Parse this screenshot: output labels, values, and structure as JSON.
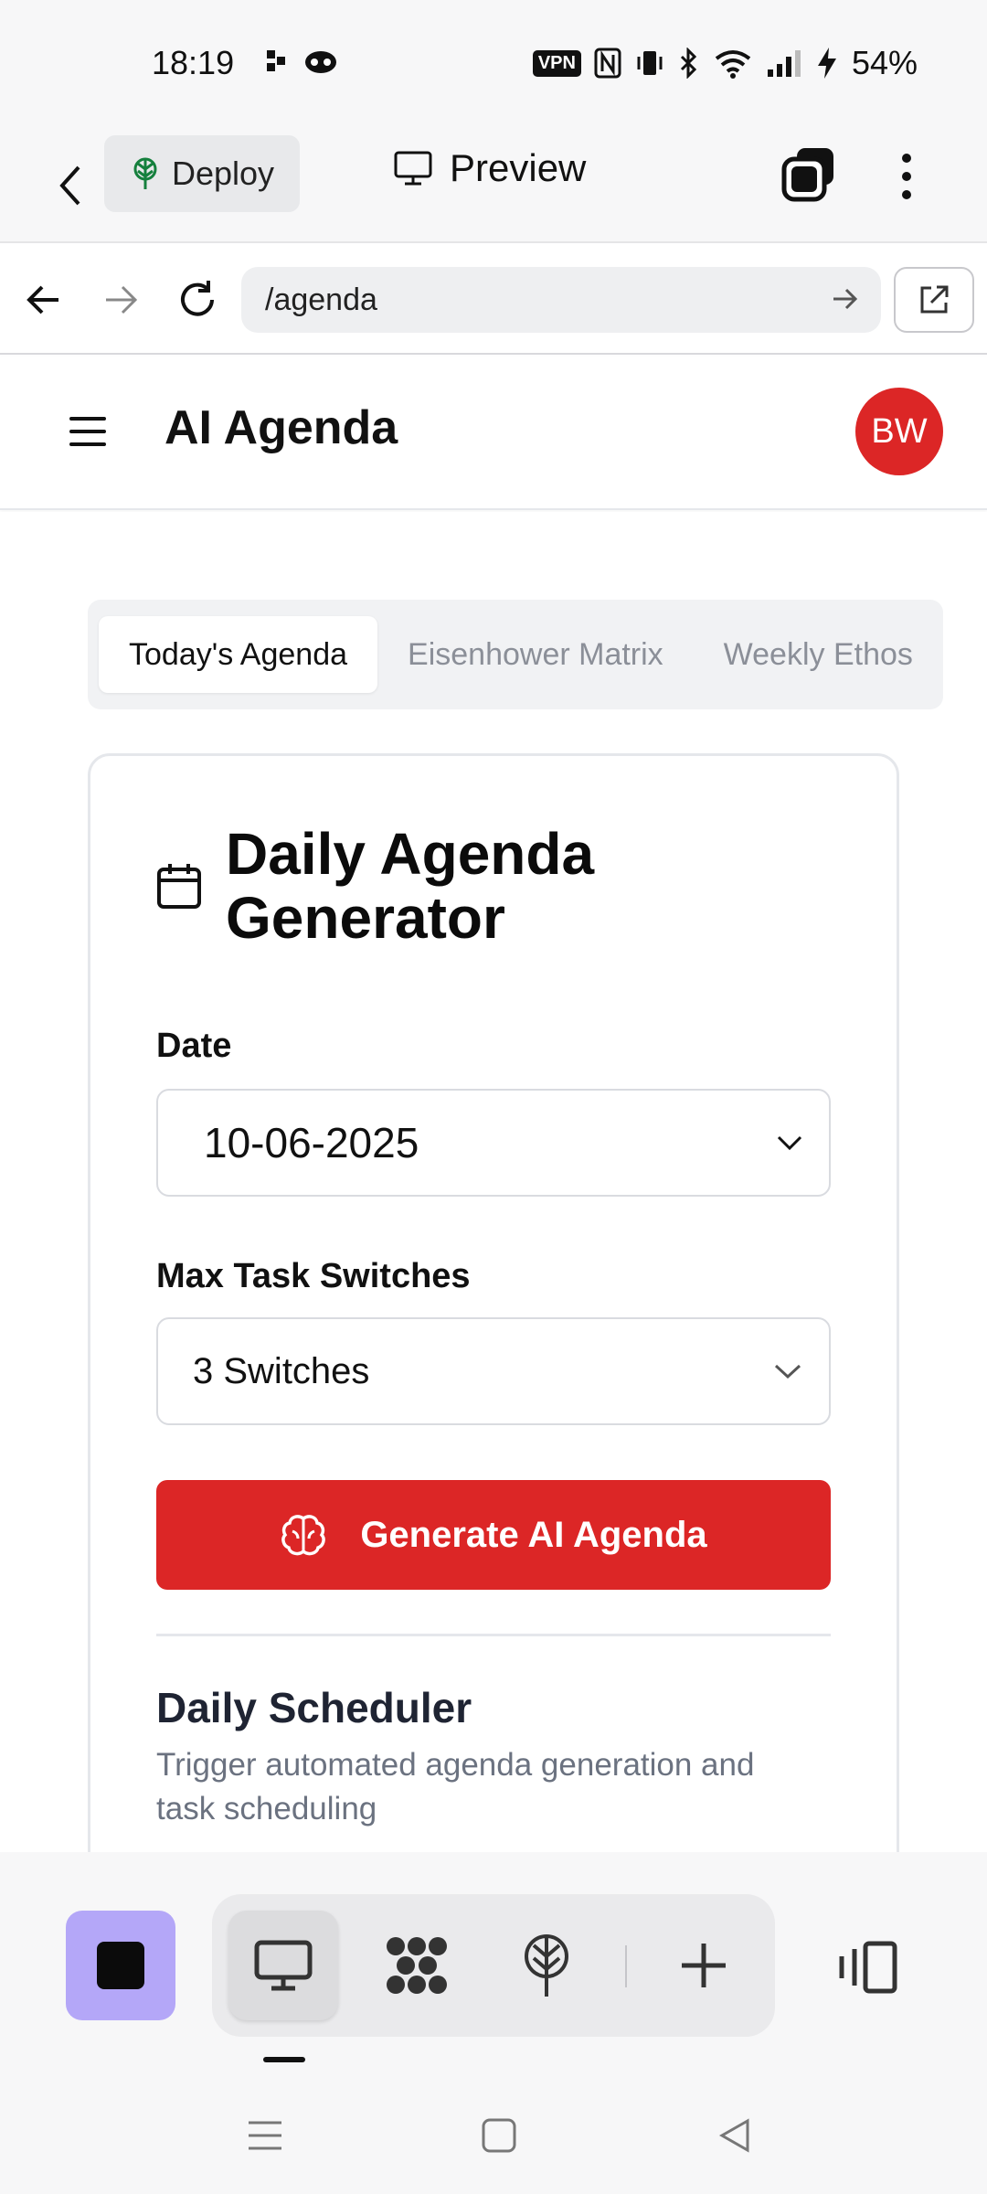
{
  "status_bar": {
    "time": "18:19",
    "vpn": "VPN",
    "battery": "54%"
  },
  "app_bar": {
    "deploy_label": "Deploy",
    "preview_label": "Preview"
  },
  "browser": {
    "url": "/agenda"
  },
  "header": {
    "title": "AI Agenda",
    "avatar_initials": "BW"
  },
  "tabs": [
    {
      "label": "Today's Agenda",
      "active": true
    },
    {
      "label": "Eisenhower Matrix",
      "active": false
    },
    {
      "label": "Weekly Ethos",
      "active": false
    }
  ],
  "card": {
    "title": "Daily Agenda Generator",
    "icon": "calendar-icon",
    "date_label": "Date",
    "date_value": "10-06-2025",
    "switches_label": "Max Task Switches",
    "switches_value": "3 Switches",
    "generate_label": "Generate AI Agenda",
    "scheduler_title": "Daily Scheduler",
    "scheduler_desc": "Trigger automated agenda generation and task scheduling"
  },
  "colors": {
    "accent": "#dc2626",
    "stop_button": "#b4a7f8"
  }
}
